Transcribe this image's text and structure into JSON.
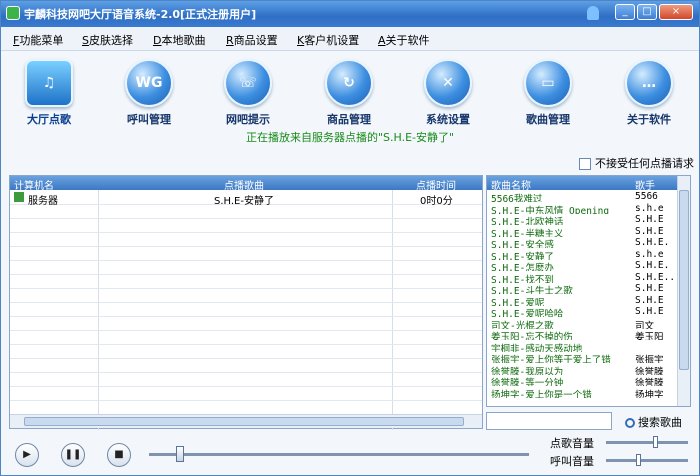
{
  "window": {
    "title": "宇麟科技网吧大厅语音系统-2.0[正式注册用户]",
    "controls": [
      "_",
      "□",
      "×"
    ]
  },
  "menu": [
    {
      "key": "F",
      "label": "功能菜单"
    },
    {
      "key": "S",
      "label": "皮肤选择"
    },
    {
      "key": "D",
      "label": "本地歌曲"
    },
    {
      "key": "R",
      "label": "商品设置"
    },
    {
      "key": "K",
      "label": "客户机设置"
    },
    {
      "key": "A",
      "label": "关于软件"
    }
  ],
  "toolbar": [
    {
      "label": "大厅点歌",
      "icon": "music-note-icon",
      "glyph": "♫"
    },
    {
      "label": "呼叫管理",
      "icon": "wg-icon",
      "glyph": "WG"
    },
    {
      "label": "网吧提示",
      "icon": "mobile-phone-icon",
      "glyph": "☏"
    },
    {
      "label": "商品管理",
      "icon": "refresh-arrow-icon",
      "glyph": "↻"
    },
    {
      "label": "系统设置",
      "icon": "tools-icon",
      "glyph": "✕"
    },
    {
      "label": "歌曲管理",
      "icon": "monitor-icon",
      "glyph": "▭"
    },
    {
      "label": "关于软件",
      "icon": "chat-bubble-icon",
      "glyph": "…"
    }
  ],
  "status": "正在播放来自服务器点播的\"S.H.E-安静了\"",
  "reject_label": "不接受任何点播请求",
  "request_table": {
    "columns": [
      "计算机名",
      "点播歌曲",
      "点播时间"
    ],
    "rows": [
      {
        "computer": "服务器",
        "song": "S.H.E-安静了",
        "time": "0时0分"
      }
    ]
  },
  "song_table": {
    "columns": [
      "歌曲名称",
      "歌手"
    ],
    "rows": [
      [
        "5566我难过",
        "5566"
      ],
      [
        "S.H.E-中东风情 Opening",
        "s.h.e"
      ],
      [
        "S.H.E-北欧神话",
        "S.H.E"
      ],
      [
        "S.H.E-半糖主义",
        "S.H.E"
      ],
      [
        "S.H.E-安全感",
        "S.H.E."
      ],
      [
        "S.H.E-安静了",
        "s.h.e"
      ],
      [
        "S.H.E-怎麽办",
        "S.H.E."
      ],
      [
        "S.H.E-找不到",
        "S.H.E..."
      ],
      [
        "S.H.E-斗牛士之歌",
        "S.H.E"
      ],
      [
        "S.H.E-爱呢",
        "S.H.E"
      ],
      [
        "S.H.E-爱呢哈哈",
        "S.H.E"
      ],
      [
        "司文-光棍之歌",
        "司文"
      ],
      [
        "姜玉阳-忘不掉的伤",
        "姜玉阳"
      ],
      [
        "宇桐非-感动天感动地",
        ""
      ],
      [
        "张振宇-爱上你等于爱上了错",
        "张振宇"
      ],
      [
        "徐誉滕-我原以为",
        "徐誉滕"
      ],
      [
        "徐誉滕-等一分钟",
        "徐誉滕"
      ],
      [
        "扬坤字-爱上你是一个错",
        "扬坤字"
      ]
    ]
  },
  "search_button": "搜索歌曲",
  "player": {
    "progress": 0.07,
    "song_volume_label": "点歌音量",
    "song_volume": 0.6,
    "call_volume_label": "呼叫音量",
    "call_volume": 0.38
  }
}
